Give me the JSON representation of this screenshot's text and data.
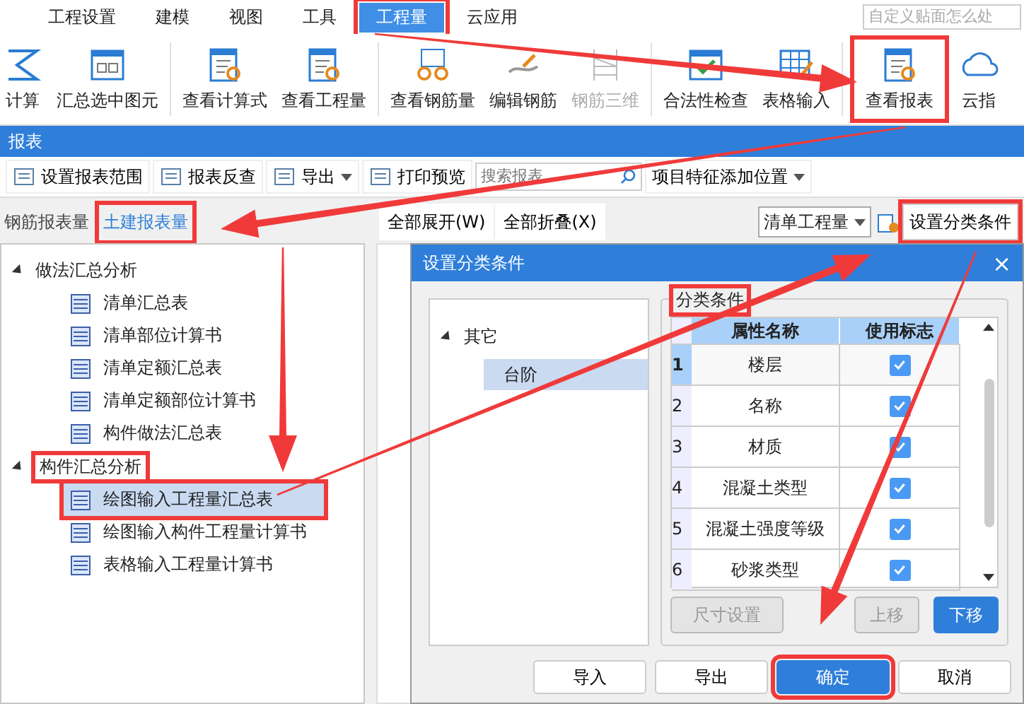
{
  "menu": {
    "tabs": [
      {
        "label": "工程设置",
        "selected": false,
        "highlighted": false
      },
      {
        "label": "建模",
        "selected": false,
        "highlighted": false
      },
      {
        "label": "视图",
        "selected": false,
        "highlighted": false
      },
      {
        "label": "工具",
        "selected": false,
        "highlighted": false
      },
      {
        "label": "工程量",
        "selected": true,
        "highlighted": true
      },
      {
        "label": "云应用",
        "selected": false,
        "highlighted": false
      }
    ],
    "search": {
      "placeholder": "自定义贴面怎么处"
    }
  },
  "ribbon": {
    "groups": [
      [
        {
          "label": "计算",
          "disabled": false,
          "highlighted": false
        },
        {
          "label": "汇总选中图元",
          "disabled": false,
          "highlighted": false
        }
      ],
      [
        {
          "label": "查看计算式",
          "disabled": false,
          "highlighted": false
        },
        {
          "label": "查看工程量",
          "disabled": false,
          "highlighted": false
        }
      ],
      [
        {
          "label": "查看钢筋量",
          "disabled": false,
          "highlighted": false
        },
        {
          "label": "编辑钢筋",
          "disabled": false,
          "highlighted": false
        },
        {
          "label": "钢筋三维",
          "disabled": true,
          "highlighted": false
        }
      ],
      [
        {
          "label": "合法性检查",
          "disabled": false,
          "highlighted": false
        },
        {
          "label": "表格输入",
          "disabled": false,
          "highlighted": false
        }
      ],
      [
        {
          "label": "查看报表",
          "disabled": false,
          "highlighted": true
        },
        {
          "label": "云指",
          "disabled": false,
          "highlighted": false
        }
      ]
    ]
  },
  "panel": {
    "title": "报表"
  },
  "toolbar": {
    "items": [
      {
        "label": "设置报表范围",
        "dropdown": false
      },
      {
        "label": "报表反查",
        "dropdown": false
      },
      {
        "label": "导出",
        "dropdown": true
      },
      {
        "label": "打印预览",
        "dropdown": false
      }
    ],
    "search": {
      "placeholder": "搜索报表"
    },
    "position_menu": {
      "label": "项目特征添加位置"
    }
  },
  "report_tabs": [
    {
      "label": "钢筋报表量",
      "selected": false,
      "highlighted": false
    },
    {
      "label": "土建报表量",
      "selected": true,
      "highlighted": true
    }
  ],
  "view_buttons": [
    "全部展开(W)",
    "全部折叠(X)"
  ],
  "quantity_select": {
    "value": "清单工程量"
  },
  "classify_button": {
    "label": "设置分类条件",
    "highlighted": true
  },
  "tree": [
    {
      "label": "做法汇总分析",
      "expanded": true,
      "highlighted": false,
      "children": [
        {
          "label": "清单汇总表",
          "selected": false,
          "highlighted": false
        },
        {
          "label": "清单部位计算书",
          "selected": false,
          "highlighted": false
        },
        {
          "label": "清单定额汇总表",
          "selected": false,
          "highlighted": false
        },
        {
          "label": "清单定额部位计算书",
          "selected": false,
          "highlighted": false
        },
        {
          "label": "构件做法汇总表",
          "selected": false,
          "highlighted": false
        }
      ]
    },
    {
      "label": "构件汇总分析",
      "expanded": true,
      "highlighted": true,
      "children": [
        {
          "label": "绘图输入工程量汇总表",
          "selected": true,
          "highlighted": true
        },
        {
          "label": "绘图输入构件工程量计算书",
          "selected": false,
          "highlighted": false
        },
        {
          "label": "表格输入工程量计算书",
          "selected": false,
          "highlighted": false
        }
      ]
    }
  ],
  "dialog": {
    "title": "设置分类条件",
    "close": "×",
    "tree": [
      {
        "label": "其它",
        "expanded": true,
        "children": [
          {
            "label": "台阶",
            "selected": true
          }
        ]
      }
    ],
    "group": {
      "label": "分类条件",
      "highlighted": true
    },
    "table": {
      "columns": [
        "属性名称",
        "使用标志"
      ],
      "rows": [
        {
          "index": "1",
          "name": "楼层",
          "checked": true,
          "selected": true
        },
        {
          "index": "2",
          "name": "名称",
          "checked": true,
          "selected": false
        },
        {
          "index": "3",
          "name": "材质",
          "checked": true,
          "selected": false
        },
        {
          "index": "4",
          "name": "混凝土类型",
          "checked": true,
          "selected": false
        },
        {
          "index": "5",
          "name": "混凝土强度等级",
          "checked": true,
          "selected": false
        },
        {
          "index": "6",
          "name": "砂浆类型",
          "checked": true,
          "selected": false
        }
      ]
    },
    "buttons": [
      {
        "label": "尺寸设置",
        "disabled": true
      },
      {
        "label": "上移",
        "disabled": true
      },
      {
        "label": "下移",
        "disabled": false
      }
    ],
    "footer": [
      {
        "label": "导入",
        "primary": false,
        "highlighted": false
      },
      {
        "label": "导出",
        "primary": false,
        "highlighted": false
      },
      {
        "label": "确定",
        "primary": true,
        "highlighted": true
      },
      {
        "label": "取消",
        "primary": false,
        "highlighted": false
      }
    ]
  }
}
